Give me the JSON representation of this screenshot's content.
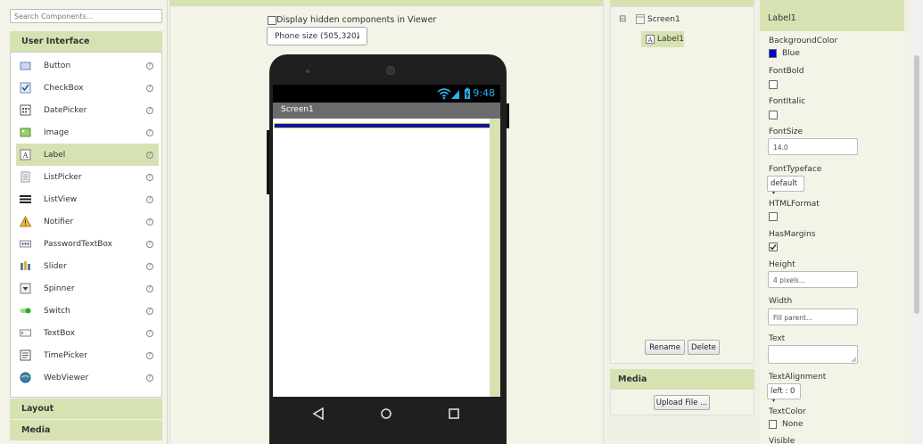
{
  "palette": {
    "search_placeholder": "Search Components...",
    "category": "User Interface",
    "items": [
      {
        "label": "Button",
        "icon": "button-icon",
        "help": "?"
      },
      {
        "label": "CheckBox",
        "icon": "checkbox-icon",
        "help": "?"
      },
      {
        "label": "DatePicker",
        "icon": "datepicker-icon",
        "help": "?"
      },
      {
        "label": "Image",
        "icon": "image-icon",
        "help": "?"
      },
      {
        "label": "Label",
        "icon": "label-icon",
        "help": "?"
      },
      {
        "label": "ListPicker",
        "icon": "listpicker-icon",
        "help": "?"
      },
      {
        "label": "ListView",
        "icon": "listview-icon",
        "help": "?"
      },
      {
        "label": "Notifier",
        "icon": "notifier-icon",
        "help": "?"
      },
      {
        "label": "PasswordTextBox",
        "icon": "password-icon",
        "help": "?"
      },
      {
        "label": "Slider",
        "icon": "slider-icon",
        "help": "?"
      },
      {
        "label": "Spinner",
        "icon": "spinner-icon",
        "help": "?"
      },
      {
        "label": "Switch",
        "icon": "switch-icon",
        "help": "?"
      },
      {
        "label": "TextBox",
        "icon": "textbox-icon",
        "help": "?"
      },
      {
        "label": "TimePicker",
        "icon": "timepicker-icon",
        "help": "?"
      },
      {
        "label": "WebViewer",
        "icon": "webviewer-icon",
        "help": "?"
      }
    ],
    "selected_index": 4,
    "other_categories": [
      "Layout",
      "Media"
    ]
  },
  "viewer": {
    "hidden_components_label": "Display hidden components in Viewer",
    "phone_size": "Phone size (505,320)",
    "status_time": "9:48",
    "screen_title": "Screen1",
    "label_color": "#1414a0"
  },
  "components": {
    "root": "Screen1",
    "child": "Label1",
    "collapse_glyph": "⊟",
    "rename_label": "Rename",
    "delete_label": "Delete"
  },
  "media": {
    "title": "Media",
    "upload_label": "Upload File ..."
  },
  "properties": {
    "title": "Label1",
    "background_color_label": "BackgroundColor",
    "background_color_value": "Blue",
    "background_color_hex": "#0000cc",
    "font_bold_label": "FontBold",
    "font_italic_label": "FontItalic",
    "font_size_label": "FontSize",
    "font_size_value": "14.0",
    "font_typeface_label": "FontTypeface",
    "font_typeface_value": "default",
    "html_format_label": "HTMLFormat",
    "has_margins_label": "HasMargins",
    "height_label": "Height",
    "height_value": "4 pixels...",
    "width_label": "Width",
    "width_value": "Fill parent...",
    "text_label": "Text",
    "text_alignment_label": "TextAlignment",
    "text_alignment_value": "left : 0",
    "text_color_label": "TextColor",
    "text_color_value": "None",
    "visible_label": "Visible"
  }
}
